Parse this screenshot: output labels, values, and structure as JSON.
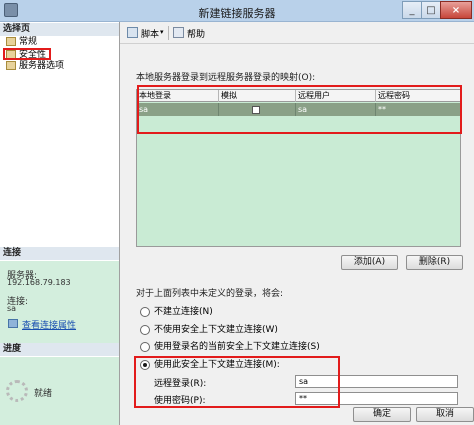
{
  "window": {
    "title": "新建链接服务器"
  },
  "titlebar": {
    "minimize": "_",
    "maximize": "□",
    "close": "×"
  },
  "sidebar": {
    "select_page": "选择页",
    "pages": [
      {
        "label": "常规",
        "selected": false
      },
      {
        "label": "安全性",
        "selected": true
      },
      {
        "label": "服务器选项",
        "selected": false
      }
    ],
    "connection": {
      "heading": "连接",
      "server_label": "服务器:",
      "server_value": "192.168.79.183",
      "connect_label": "连接:",
      "connect_value": "sa",
      "view_props_link": "查看连接属性"
    },
    "progress": {
      "heading": "进度",
      "status": "就绪"
    }
  },
  "toolbar": {
    "script_label": "脚本",
    "dropdown_arrow": "▾",
    "help_label": "帮助"
  },
  "mapping": {
    "section_label": "本地服务器登录到远程服务器登录的映射(O):",
    "columns": [
      "本地登录",
      "模拟",
      "远程用户",
      "远程密码"
    ],
    "rows": [
      {
        "local": "sa",
        "impersonate": false,
        "remote_user": "sa",
        "remote_password": "**"
      }
    ],
    "add_button": "添加(A)",
    "delete_button": "删除(R)"
  },
  "undefined_logins": {
    "label": "对于上面列表中未定义的登录，将会:",
    "options": [
      {
        "label": "不建立连接(N)",
        "selected": false
      },
      {
        "label": "不使用安全上下文建立连接(W)",
        "selected": false
      },
      {
        "label": "使用登录名的当前安全上下文建立连接(S)",
        "selected": false
      },
      {
        "label": "使用此安全上下文建立连接(M):",
        "selected": true
      }
    ],
    "remote_login_label": "远程登录(R):",
    "remote_login_value": "sa",
    "password_label": "使用密码(P):",
    "password_value": "**"
  },
  "footer": {
    "ok_button": "确定",
    "cancel_button": "取消"
  },
  "colors": {
    "highlight_box": "#e21b1b",
    "grid_background": "#c9ebd4",
    "selected_row": "#8aa087"
  }
}
